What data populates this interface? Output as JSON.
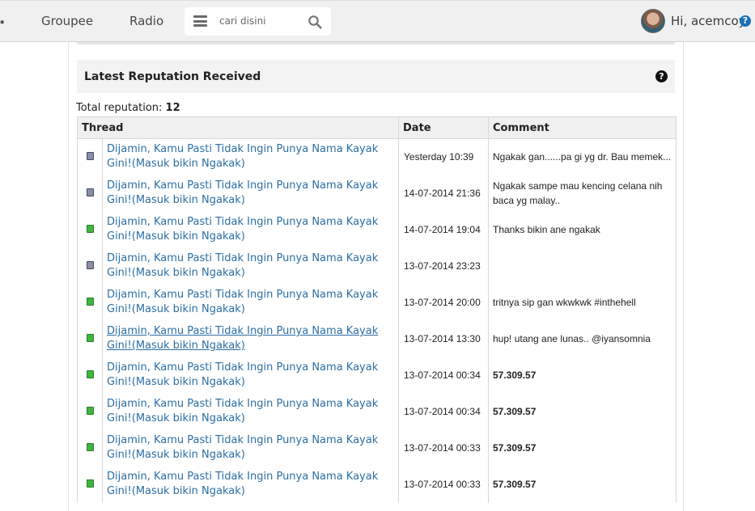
{
  "nav": {
    "items": [
      "Groupee",
      "Radio"
    ],
    "search_placeholder": "cari disini",
    "greeting": "Hi, acemcoy",
    "help": "?"
  },
  "section": {
    "title": "Latest Reputation Received",
    "help": "?",
    "total_label": "Total reputation:",
    "total_value": "12"
  },
  "table": {
    "headers": {
      "thread": "Thread",
      "date": "Date",
      "comment": "Comment"
    },
    "rows": [
      {
        "indicator": "gray",
        "thread": "Dijamin, Kamu Pasti Tidak Ingin Punya Nama Kayak Gini!(Masuk bikin Ngakak)",
        "date": "Yesterday 10:39",
        "comment": "Ngakak gan......pa gi yg dr. Bau memek...",
        "comment_bold": false,
        "hovered": false
      },
      {
        "indicator": "gray",
        "thread": "Dijamin, Kamu Pasti Tidak Ingin Punya Nama Kayak Gini!(Masuk bikin Ngakak)",
        "date": "14-07-2014 21:36",
        "comment": "Ngakak sampe mau kencing celana nih baca yg malay..",
        "comment_bold": false,
        "hovered": false
      },
      {
        "indicator": "green",
        "thread": "Dijamin, Kamu Pasti Tidak Ingin Punya Nama Kayak Gini!(Masuk bikin Ngakak)",
        "date": "14-07-2014 19:04",
        "comment": "Thanks bikin ane ngakak",
        "comment_bold": false,
        "hovered": false
      },
      {
        "indicator": "gray",
        "thread": "Dijamin, Kamu Pasti Tidak Ingin Punya Nama Kayak Gini!(Masuk bikin Ngakak)",
        "date": "13-07-2014 23:23",
        "comment": "",
        "comment_bold": false,
        "hovered": false
      },
      {
        "indicator": "green",
        "thread": "Dijamin, Kamu Pasti Tidak Ingin Punya Nama Kayak Gini!(Masuk bikin Ngakak)",
        "date": "13-07-2014 20:00",
        "comment": "tritnya sip gan wkwkwk #inthehell",
        "comment_bold": false,
        "hovered": false
      },
      {
        "indicator": "green",
        "thread": "Dijamin, Kamu Pasti Tidak Ingin Punya Nama Kayak Gini!(Masuk bikin Ngakak)",
        "date": "13-07-2014 13:30",
        "comment": "hup! utang ane lunas.. @iyansomnia",
        "comment_bold": false,
        "hovered": true
      },
      {
        "indicator": "green",
        "thread": "Dijamin, Kamu Pasti Tidak Ingin Punya Nama Kayak Gini!(Masuk bikin Ngakak)",
        "date": "13-07-2014 00:34",
        "comment": "57.309.57",
        "comment_bold": true,
        "hovered": false
      },
      {
        "indicator": "green",
        "thread": "Dijamin, Kamu Pasti Tidak Ingin Punya Nama Kayak Gini!(Masuk bikin Ngakak)",
        "date": "13-07-2014 00:34",
        "comment": "57.309.57",
        "comment_bold": true,
        "hovered": false
      },
      {
        "indicator": "green",
        "thread": "Dijamin, Kamu Pasti Tidak Ingin Punya Nama Kayak Gini!(Masuk bikin Ngakak)",
        "date": "13-07-2014 00:33",
        "comment": "57.309.57",
        "comment_bold": true,
        "hovered": false
      },
      {
        "indicator": "green",
        "thread": "Dijamin, Kamu Pasti Tidak Ingin Punya Nama Kayak Gini!(Masuk bikin Ngakak)",
        "date": "13-07-2014 00:33",
        "comment": "57.309.57",
        "comment_bold": true,
        "hovered": false
      }
    ]
  },
  "colors": {
    "link": "#2c6ea3",
    "positive": "#3fb43f",
    "neutral": "#8a8fa6",
    "help_badge": "#1c6fb5"
  }
}
